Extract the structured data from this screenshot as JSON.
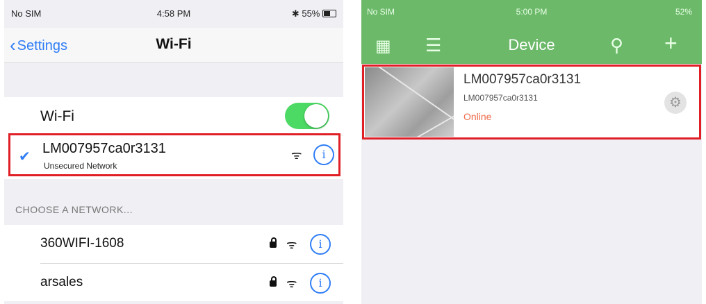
{
  "left": {
    "status_bar": {
      "carrier": "No SIM",
      "time": "4:58 PM",
      "battery": "55%"
    },
    "nav": {
      "back_label": "Settings",
      "title": "Wi-Fi"
    },
    "wifi_row": {
      "label": "Wi-Fi",
      "toggle_on": true
    },
    "connected": {
      "ssid": "LM007957ca0r3131",
      "subtitle": "Unsecured Network"
    },
    "section_header": "CHOOSE A NETWORK...",
    "networks": [
      {
        "ssid": "360WIFI-1608",
        "secured": true
      },
      {
        "ssid": "arsales",
        "secured": true
      }
    ],
    "colors": {
      "accent": "#2f7df6",
      "toggle": "#4cd964",
      "highlight": "#e01e26"
    }
  },
  "right": {
    "status_bar": {
      "carrier": "No SIM",
      "time": "5:00 PM",
      "battery": "52%"
    },
    "header": {
      "title": "Device"
    },
    "device": {
      "name": "LM007957ca0r3131",
      "id": "LM007957ca0r3131",
      "status": "Online"
    },
    "colors": {
      "header_bg": "#6cb96a",
      "status_online": "#ef6b4a",
      "highlight": "#e01e26"
    }
  }
}
